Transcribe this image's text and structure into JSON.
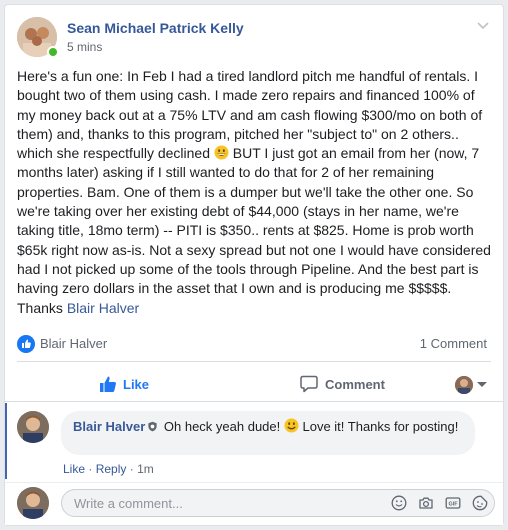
{
  "post": {
    "author": "Sean Michael Patrick Kelly",
    "time": "5 mins",
    "text_1": "Here's a fun one: In Feb I had a tired landlord pitch me handful of rentals. I bought two of them using cash. I made zero repairs and financed 100% of my money back out at a 75% LTV and am cash flowing $300/mo on both of them) and, thanks to this program, pitched her \"subject to\" on 2 others.. which she respectfully declined ",
    "text_2": " BUT I just got an email from her (now, 7 months later) asking if I still wanted to do that for 2 of her remaining properties. Bam. One of them is a dumper but we'll take the other one. So we're taking over her existing debt of $44,000 (stays in her name, we're taking title, 18mo term) -- PITI is $350.. rents at $825. Home is prob worth $65k right now as-is. Not a sexy spread but not one I would have considered had I not picked up some of the tools through Pipeline. And the best part is having zero dollars in the asset that I own and is producing me $$$$$. Thanks ",
    "mention": "Blair Halver"
  },
  "reactions": {
    "reactor": "Blair Halver",
    "comment_count": "1 Comment"
  },
  "actions": {
    "like": "Like",
    "comment": "Comment"
  },
  "comment": {
    "author": "Blair Halver",
    "text_1": "Oh heck yeah dude! ",
    "text_2": " Love it! Thanks for posting!",
    "like": "Like",
    "reply": "Reply",
    "separator": "·",
    "age": "1m"
  },
  "composer": {
    "placeholder": "Write a comment..."
  },
  "colors": {
    "link": "#385898",
    "accent": "#1877f2",
    "online": "#42b72a"
  }
}
